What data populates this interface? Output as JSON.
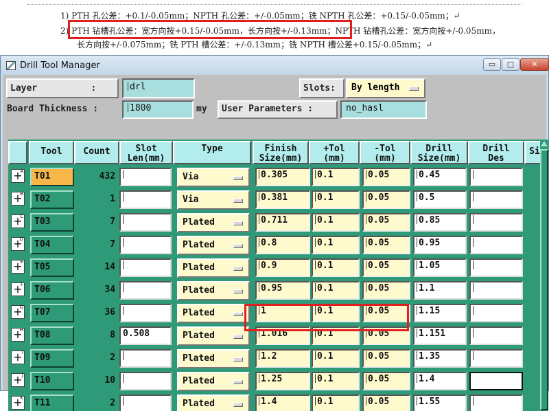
{
  "document": {
    "line1": "1) PTH 孔公差：+0.1/-0.05mm；NPTH 孔公差：+/-0.05mm；铣 NPTH 孔公差：+0.15/-0.05mm；↵",
    "line2_a": "2) PTH 钻槽孔公差：宽方向按+0.15/-0.05mm，长方向按+/-0.13mm；",
    "line2_b": "NPTH 钻槽孔公差：宽方向按+/-0.05mm，",
    "line3": "长方向按+/-0.075mm；铣 PTH 槽公差：+/-0.13mm；铣 NPTH 槽公差+0.15/-0.05mm；↵"
  },
  "window": {
    "title": "Drill Tool Manager",
    "min": "▭",
    "max": "□",
    "close": "✕"
  },
  "form": {
    "layer_label": "Layer          :",
    "layer_value": "drl",
    "slots_label": "Slots:",
    "slots_value": "By length",
    "board_label": "Board Thickness :",
    "board_value": "1800",
    "board_unit": "my",
    "user_params_label": "User Parameters :",
    "user_params_value": "no_hasl"
  },
  "table": {
    "headers": [
      "Tool",
      "Count",
      "Slot\nLen(mm)",
      "Type",
      "Finish\nSize(mm)",
      "+Tol\n(mm)",
      "-Tol\n(mm)",
      "Drill\nSize(mm)",
      "Drill\nDes",
      "Si"
    ],
    "rows": [
      {
        "sup": "A",
        "tool": "T01",
        "count": "432",
        "slot": "",
        "type": "Via",
        "finish": "0.305",
        "ptol": "0.1",
        "ntol": "0.05",
        "drill": "0.45"
      },
      {
        "sup": "B",
        "tool": "T02",
        "count": "1",
        "slot": "",
        "type": "Via",
        "finish": "0.381",
        "ptol": "0.1",
        "ntol": "0.05",
        "drill": "0.5"
      },
      {
        "sup": "C",
        "tool": "T03",
        "count": "7",
        "slot": "",
        "type": "Plated",
        "finish": "0.711",
        "ptol": "0.1",
        "ntol": "0.05",
        "drill": "0.85"
      },
      {
        "sup": "D",
        "tool": "T04",
        "count": "7",
        "slot": "",
        "type": "Plated",
        "finish": "0.8",
        "ptol": "0.1",
        "ntol": "0.05",
        "drill": "0.95"
      },
      {
        "sup": "E",
        "tool": "T05",
        "count": "14",
        "slot": "",
        "type": "Plated",
        "finish": "0.9",
        "ptol": "0.1",
        "ntol": "0.05",
        "drill": "1.05"
      },
      {
        "sup": "F",
        "tool": "T06",
        "count": "34",
        "slot": "",
        "type": "Plated",
        "finish": "0.95",
        "ptol": "0.1",
        "ntol": "0.05",
        "drill": "1.1"
      },
      {
        "sup": "G",
        "tool": "T07",
        "count": "36",
        "slot": "",
        "type": "Plated",
        "finish": "1",
        "ptol": "0.1",
        "ntol": "0.05",
        "drill": "1.15"
      },
      {
        "sup": "H",
        "tool": "T08",
        "count": "8",
        "slot": "0.508",
        "type": "Plated",
        "finish": "1.016",
        "ptol": "0.1",
        "ntol": "0.05",
        "drill": "1.151"
      },
      {
        "sup": "I",
        "tool": "T09",
        "count": "2",
        "slot": "",
        "type": "Plated",
        "finish": "1.2",
        "ptol": "0.1",
        "ntol": "0.05",
        "drill": "1.35"
      },
      {
        "sup": "J",
        "tool": "T10",
        "count": "10",
        "slot": "",
        "type": "Plated",
        "finish": "1.25",
        "ptol": "0.1",
        "ntol": "0.05",
        "drill": "1.4"
      },
      {
        "sup": "K",
        "tool": "T11",
        "count": "2",
        "slot": "",
        "type": "Plated",
        "finish": "1.4",
        "ptol": "0.1",
        "ntol": "0.05",
        "drill": "1.55"
      }
    ]
  },
  "colors": {
    "grid_bg": "#2f9a78",
    "header_bg": "#b2ecec",
    "field_bg": "#a8dede",
    "yellow": "#fffacd",
    "selected_tool": "#f7b649",
    "highlight": "#e02020"
  }
}
